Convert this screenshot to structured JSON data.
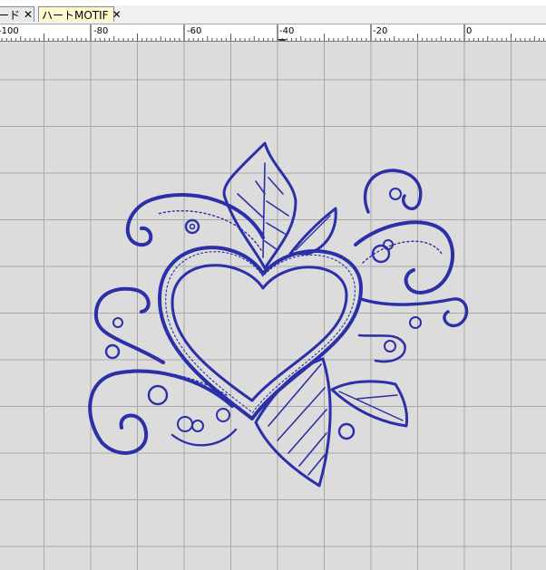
{
  "tabs": [
    {
      "label": "ード",
      "close_icon": "close-icon"
    },
    {
      "label": "ハートMOTIF",
      "close_icon": "close-icon",
      "active": true
    }
  ],
  "ruler": {
    "ticks": [
      "-100",
      "-80",
      "-60",
      "-40",
      "-20",
      "0"
    ]
  },
  "colors": {
    "stitch": "#2b2fa8",
    "grid": "#a8a8a8",
    "canvas": "#dcdcdc",
    "active_tab": "#fff8cf"
  },
  "design": {
    "icon": "heart-motif-embroidery"
  }
}
